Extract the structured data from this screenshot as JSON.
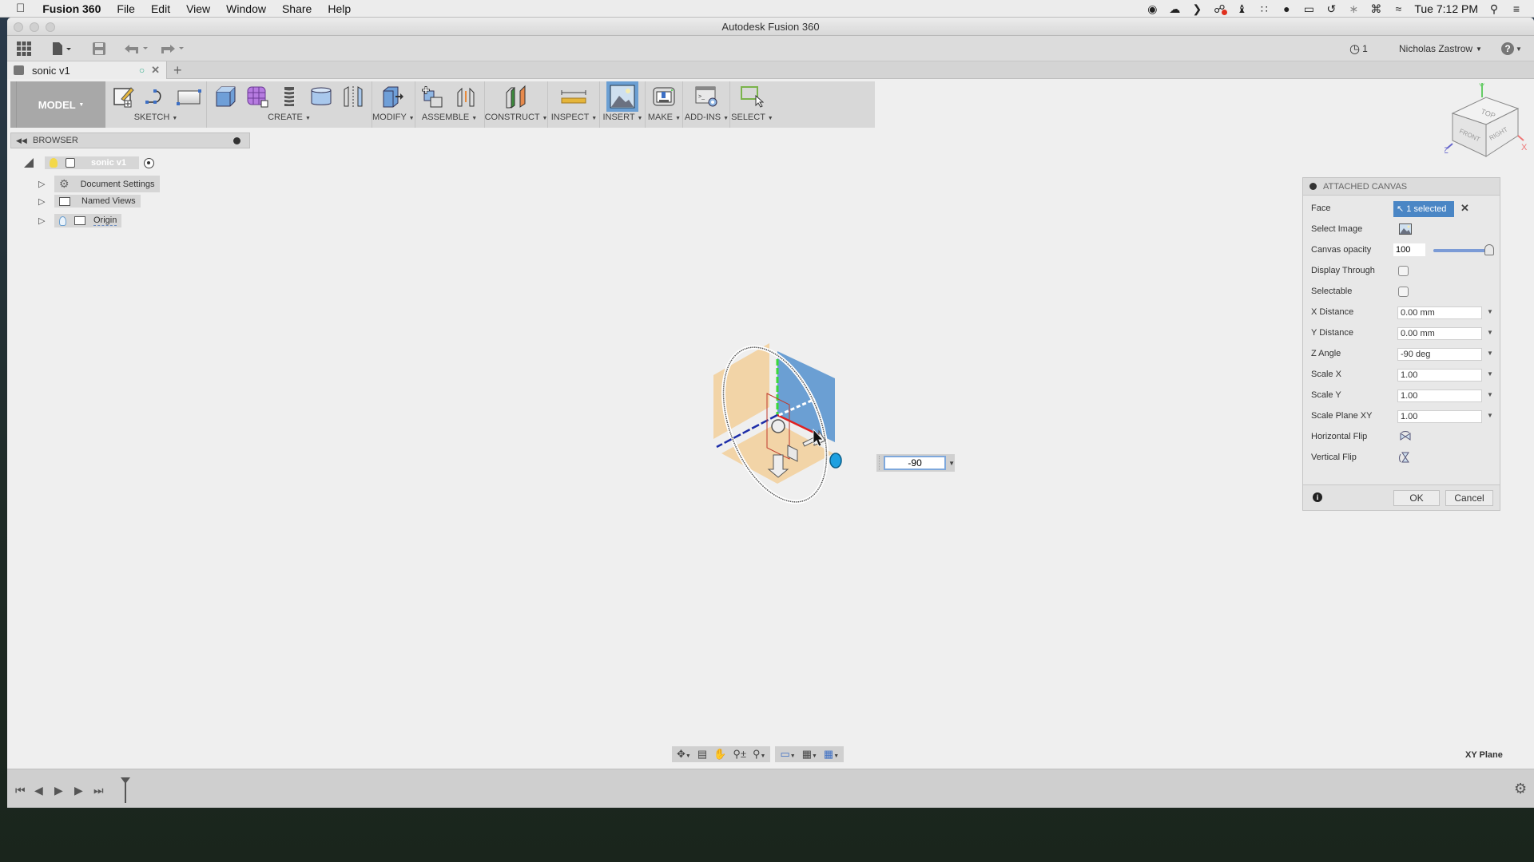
{
  "menubar": {
    "app_name": "Fusion 360",
    "items": [
      "File",
      "Edit",
      "View",
      "Window",
      "Share",
      "Help"
    ],
    "clock": "Tue 7:12 PM",
    "status_icons": [
      "record-icon",
      "cloud-upload-icon",
      "chevron-icon",
      "creative-cloud-icon",
      "ghost-icon",
      "grid-dots-icon",
      "chat-bubble-icon",
      "display-icon",
      "time-machine-icon",
      "bluetooth-icon",
      "keyboard-icon",
      "wifi-icon",
      "spotlight-icon",
      "notification-list-icon"
    ]
  },
  "window": {
    "title": "Autodesk Fusion 360",
    "job_count": "1",
    "user_name": "Nicholas Zastrow",
    "help": "?"
  },
  "tabs": [
    {
      "label": "sonic v1"
    }
  ],
  "ribbon": {
    "workspace": "MODEL",
    "groups": [
      {
        "label": "SKETCH",
        "icons": [
          "create-sketch-icon",
          "spline-icon",
          "rectangle-icon"
        ]
      },
      {
        "label": "CREATE",
        "icons": [
          "box-icon",
          "form-icon",
          "coil-icon",
          "cylinder-icon",
          "mirror-icon"
        ]
      },
      {
        "label": "MODIFY",
        "icons": [
          "press-pull-icon"
        ]
      },
      {
        "label": "ASSEMBLE",
        "icons": [
          "new-component-icon",
          "joint-icon"
        ]
      },
      {
        "label": "CONSTRUCT",
        "icons": [
          "plane-icon"
        ]
      },
      {
        "label": "INSPECT",
        "icons": [
          "measure-icon"
        ]
      },
      {
        "label": "INSERT",
        "icons": [
          "attached-canvas-icon"
        ]
      },
      {
        "label": "MAKE",
        "icons": [
          "3d-print-icon"
        ]
      },
      {
        "label": "ADD-INS",
        "icons": [
          "scripts-icon"
        ]
      },
      {
        "label": "SELECT",
        "icons": [
          "select-icon"
        ]
      }
    ]
  },
  "browser": {
    "title": "BROWSER",
    "root": "sonic v1",
    "items": [
      "Document Settings",
      "Named Views",
      "Origin"
    ]
  },
  "viewport": {
    "angle_input": "-90",
    "plane_label": "XY Plane",
    "viewcube": {
      "top": "TOP",
      "front": "FRONT",
      "right": "RIGHT",
      "axes": [
        "X",
        "Y",
        "Z"
      ]
    }
  },
  "panel": {
    "title": "ATTACHED CANVAS",
    "face_label": "Face",
    "face_value": "1 selected",
    "select_image_label": "Select Image",
    "opacity_label": "Canvas opacity",
    "opacity_value": "100",
    "opacity_fraction": 1.0,
    "display_through_label": "Display Through",
    "display_through_checked": false,
    "selectable_label": "Selectable",
    "selectable_checked": false,
    "fields": [
      {
        "label": "X Distance",
        "value": "0.00 mm"
      },
      {
        "label": "Y Distance",
        "value": "0.00 mm"
      },
      {
        "label": "Z Angle",
        "value": "-90 deg"
      },
      {
        "label": "Scale X",
        "value": "1.00"
      },
      {
        "label": "Scale Y",
        "value": "1.00"
      },
      {
        "label": "Scale Plane XY",
        "value": "1.00"
      }
    ],
    "horizontal_flip_label": "Horizontal Flip",
    "vertical_flip_label": "Vertical Flip",
    "ok": "OK",
    "cancel": "Cancel"
  }
}
